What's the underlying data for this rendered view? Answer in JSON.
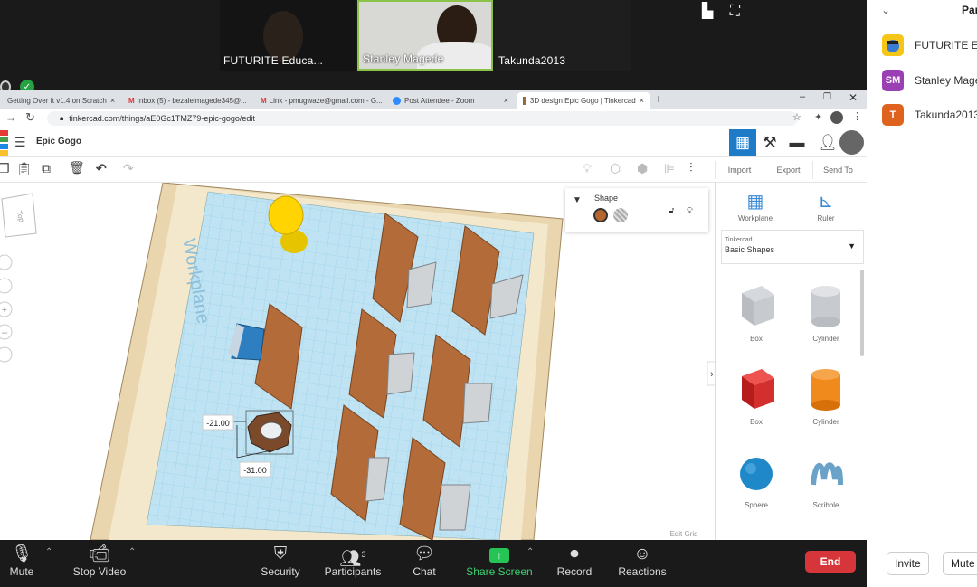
{
  "video": {
    "tiles": [
      {
        "name": "FUTURITE Educa..."
      },
      {
        "name": "Stanley Magede"
      },
      {
        "name": "Takunda2013"
      }
    ]
  },
  "participants_panel": {
    "title": "Par",
    "people": [
      {
        "initials": "",
        "name": "FUTURITE Edu",
        "color": "#f5c518"
      },
      {
        "initials": "SM",
        "name": "Stanley Mage",
        "color": "#9b3fb5"
      },
      {
        "initials": "T",
        "name": "Takunda2013",
        "color": "#e0621f"
      }
    ],
    "invite_label": "Invite",
    "mute_label": "Mute A"
  },
  "browser": {
    "tabs": [
      {
        "label": "Getting Over It v1.4 on Scratch"
      },
      {
        "label": "Inbox (5) - bezalelmagede345@..."
      },
      {
        "label": "Link - pmugwaze@gmail.com - G..."
      },
      {
        "label": "Post Attendee - Zoom"
      },
      {
        "label": "3D design Epic Gogo | Tinkercad"
      }
    ],
    "new_tab": "+",
    "url": "tinkercad.com/things/aE0Gc1TMZ79-epic-gogo/edit"
  },
  "tinkercad": {
    "design_name": "Epic Gogo",
    "logo_letters": [
      "T",
      "I",
      "N",
      "K",
      "E",
      "R",
      "C",
      "A",
      "D"
    ],
    "toolbar_buttons": {
      "import": "Import",
      "export": "Export",
      "send_to": "Send To"
    },
    "view_cube_label": "Top",
    "workplane_label": "Workplane",
    "dimensions": {
      "d1": "-21.00",
      "d2": "-31.00"
    },
    "edit_grid": "Edit Grid",
    "shape_panel": {
      "title": "Shape",
      "solid_color": "#b5652e"
    },
    "right_tools": {
      "workplane": "Workplane",
      "ruler": "Ruler"
    },
    "category_small": "Tinkercad",
    "category": "Basic Shapes",
    "shapes": [
      {
        "label": "Box",
        "icon": "box-hole-icon"
      },
      {
        "label": "Cylinder",
        "icon": "cylinder-hole-icon"
      },
      {
        "label": "Box",
        "icon": "box-red-icon",
        "color": "#d32f2f"
      },
      {
        "label": "Cylinder",
        "icon": "cylinder-orange-icon",
        "color": "#f08a1c"
      },
      {
        "label": "Sphere",
        "icon": "sphere-blue-icon",
        "color": "#1e88c8"
      },
      {
        "label": "Scribble",
        "icon": "scribble-icon",
        "color": "#6ba3c8"
      }
    ]
  },
  "zoom_controls": {
    "mute": "Mute",
    "stop_video": "Stop Video",
    "security": "Security",
    "participants": "Participants",
    "participants_count": "3",
    "chat": "Chat",
    "share_screen": "Share Screen",
    "record": "Record",
    "reactions": "Reactions",
    "end": "End"
  }
}
